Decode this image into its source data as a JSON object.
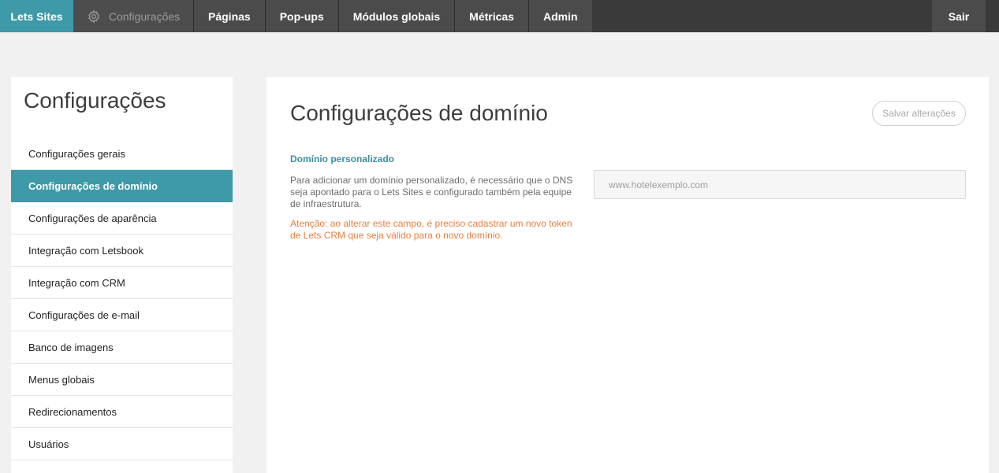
{
  "topbar": {
    "brand": "Lets Sites",
    "config_label": "Configurações",
    "config_icon": "gear-icon",
    "nav": [
      "Páginas",
      "Pop-ups",
      "Módulos globais",
      "Métricas",
      "Admin"
    ],
    "logout": "Sair"
  },
  "sidebar": {
    "title": "Configurações",
    "items": [
      "Configurações gerais",
      "Configurações de domínio",
      "Configurações de aparência",
      "Integração com Letsbook",
      "Integração com CRM",
      "Configurações de e-mail",
      "Banco de imagens",
      "Menus globais",
      "Redirecionamentos",
      "Usuários"
    ],
    "active_item": "Configurações de domínio"
  },
  "main": {
    "title": "Configurações de domínio",
    "save_label": "Salvar alterações",
    "section_label": "Domínio personalizado",
    "description": "Para adicionar um domínio personalizado, é necessário que o DNS seja apontado para o Lets Sites e configurado também pela equipe de infraestrutura.",
    "warning": "Atenção: ao alterar este campo, é preciso cadastrar um novo token de Lets CRM que seja válido para o novo domínio.",
    "domain_input": {
      "value": "",
      "placeholder": "www.hotelexemplo.com"
    }
  },
  "colors": {
    "accent": "#3e9aa8",
    "topbar": "#3a3a3a",
    "warning": "#ee7d3b"
  }
}
